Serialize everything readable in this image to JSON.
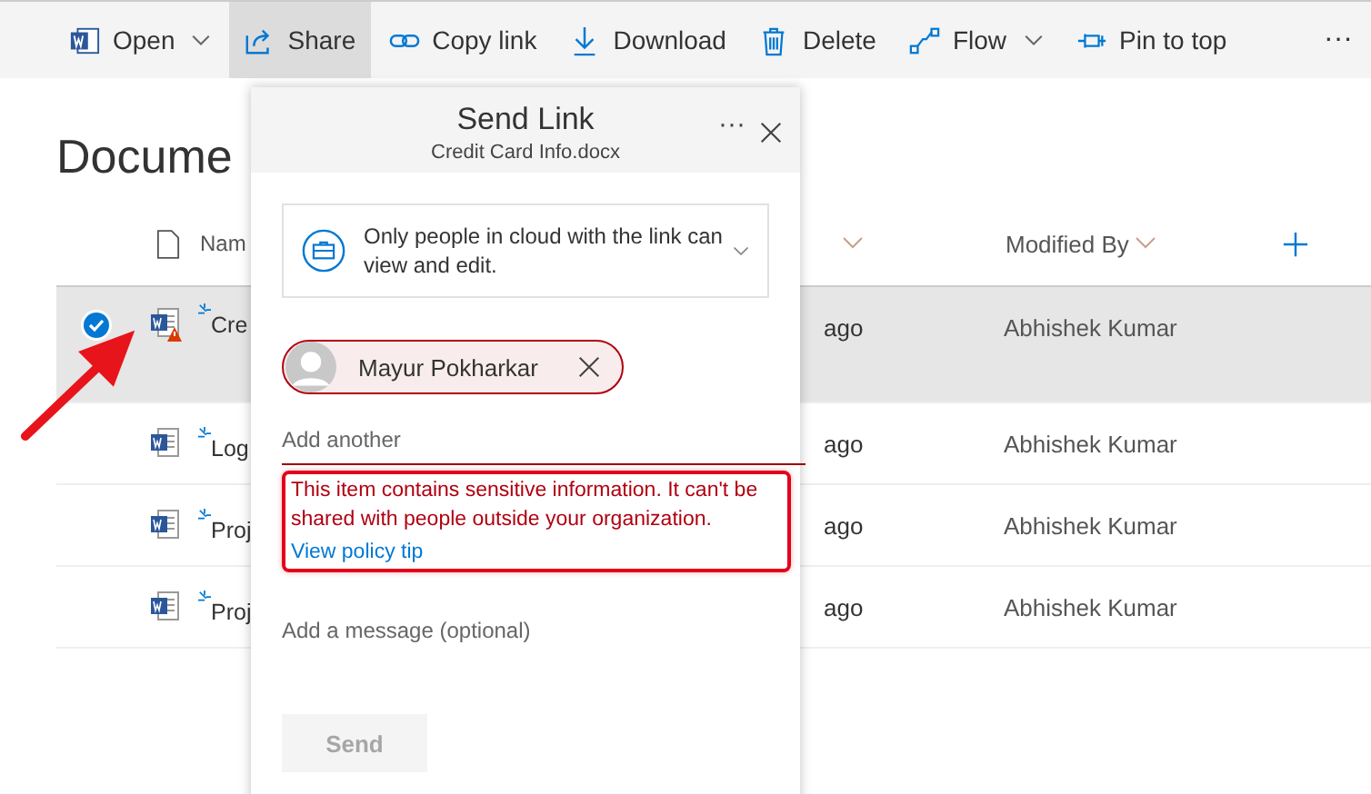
{
  "toolbar": {
    "items": [
      {
        "label": "Open",
        "kind": "word",
        "dropdown": true,
        "selected": false
      },
      {
        "label": "Share",
        "kind": "share",
        "dropdown": false,
        "selected": true
      },
      {
        "label": "Copy link",
        "kind": "link",
        "dropdown": false,
        "selected": false
      },
      {
        "label": "Download",
        "kind": "download",
        "dropdown": false,
        "selected": false
      },
      {
        "label": "Delete",
        "kind": "delete",
        "dropdown": false,
        "selected": false
      },
      {
        "label": "Flow",
        "kind": "flow",
        "dropdown": true,
        "selected": false
      },
      {
        "label": "Pin to top",
        "kind": "pin",
        "dropdown": false,
        "selected": false
      }
    ],
    "more": "···"
  },
  "library": {
    "title": "Docume",
    "columns": {
      "name": "Nam",
      "modified_by": "Modified By"
    },
    "rows": [
      {
        "name": "Cre",
        "modified": "ago",
        "modified_by": "Abhishek Kumar",
        "selected": true,
        "warning": true
      },
      {
        "name": "Log",
        "modified": "ago",
        "modified_by": "Abhishek Kumar",
        "selected": false,
        "warning": false
      },
      {
        "name": "Proj",
        "modified": "ago",
        "modified_by": "Abhishek Kumar",
        "selected": false,
        "warning": false
      },
      {
        "name": "Proj",
        "modified": "ago",
        "modified_by": "Abhishek Kumar",
        "selected": false,
        "warning": false
      }
    ]
  },
  "share_panel": {
    "title": "Send Link",
    "subtitle": "Credit Card Info.docx",
    "more": "···",
    "link_setting": "Only people in cloud with the link can view and edit.",
    "recipients": [
      {
        "name": "Mayur Pokharkar",
        "blocked": true
      }
    ],
    "add_placeholder": "Add another",
    "policy_warning": {
      "text": "This item contains sensitive information. It can't be shared with people outside your organization.",
      "link": "View policy tip"
    },
    "message_placeholder": "Add a message (optional)",
    "send": {
      "label": "Send",
      "disabled": true
    }
  }
}
